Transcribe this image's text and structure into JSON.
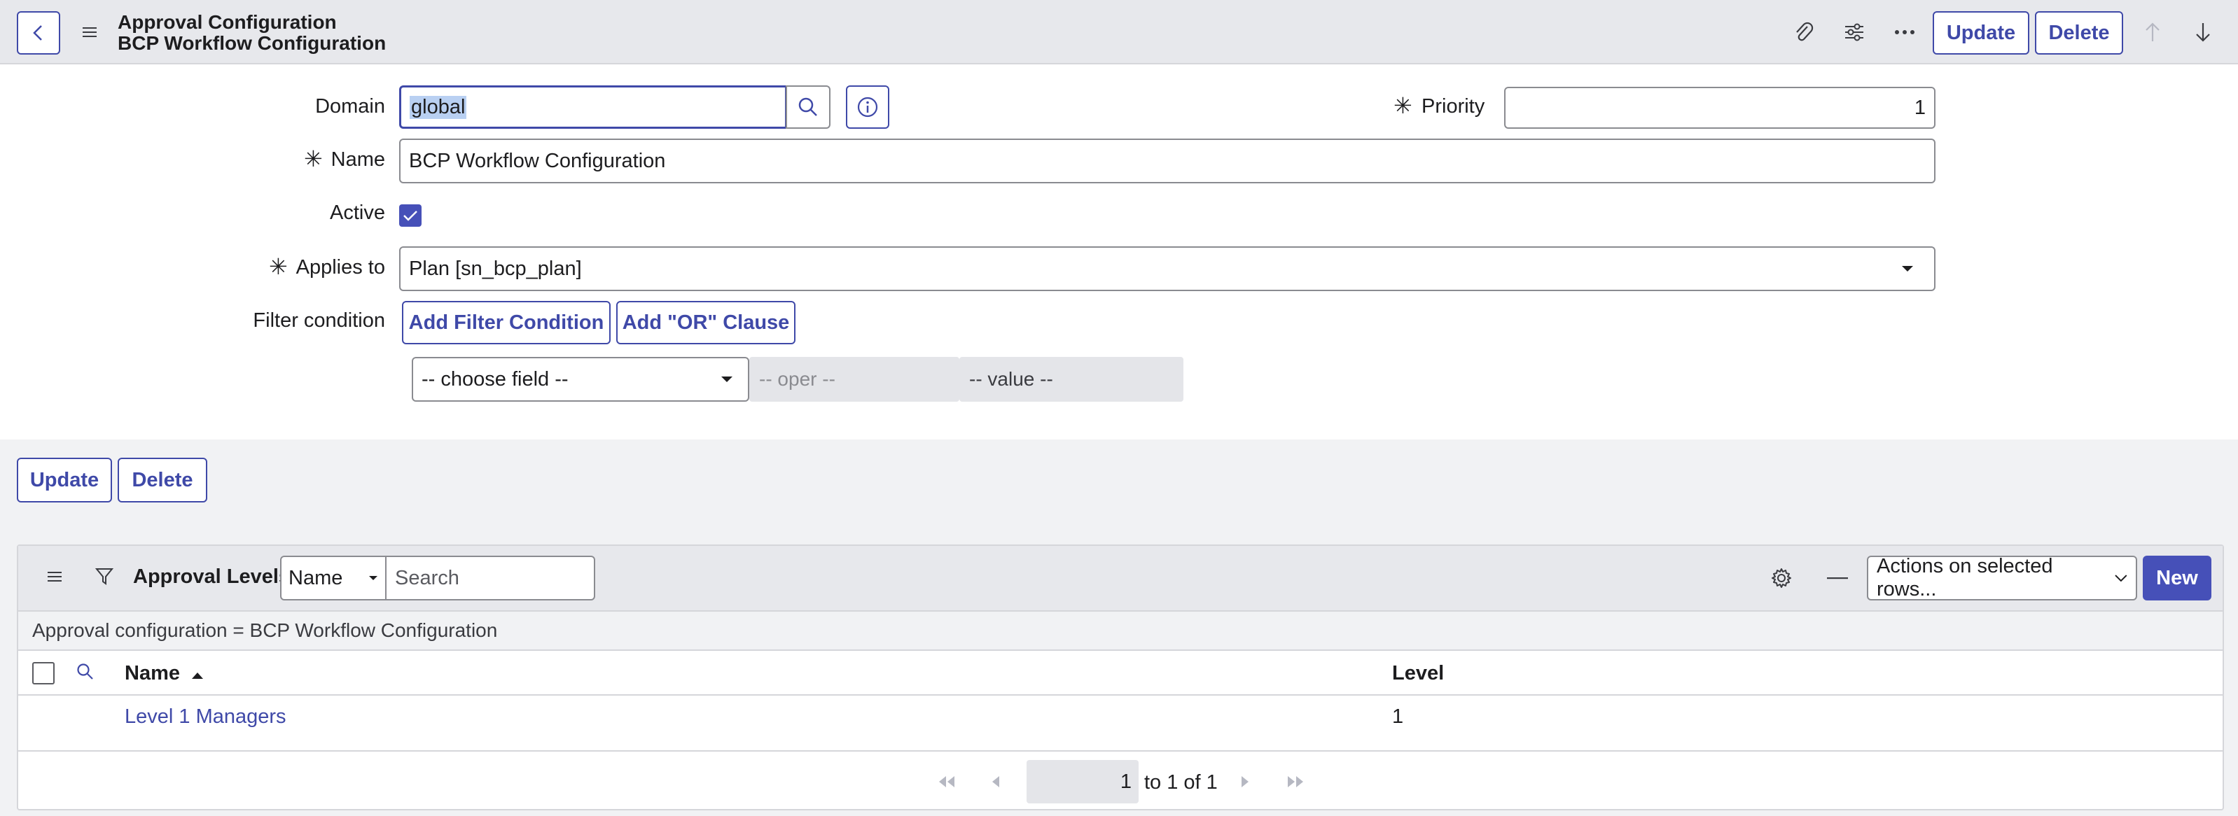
{
  "header": {
    "title": "Approval Configuration",
    "subtitle": "BCP Workflow Configuration",
    "update_label": "Update",
    "delete_label": "Delete"
  },
  "form": {
    "domain_label": "Domain",
    "domain_value": "global",
    "priority_label": "Priority",
    "priority_value": "1",
    "name_label": "Name",
    "name_value": "BCP Workflow Configuration",
    "active_label": "Active",
    "active_checked": true,
    "applies_to_label": "Applies to",
    "applies_to_value": "Plan [sn_bcp_plan]",
    "filter_label": "Filter condition",
    "add_filter_label": "Add Filter Condition",
    "add_or_label": "Add \"OR\" Clause",
    "choose_field": "-- choose field --",
    "oper": "-- oper --",
    "value": "-- value --",
    "required_mark": "✳"
  },
  "bottom_buttons": {
    "update_label": "Update",
    "delete_label": "Delete"
  },
  "related_list": {
    "title": "Approval Levels",
    "search_field": "Name",
    "search_placeholder": "Search",
    "actions_label": "Actions on selected rows...",
    "new_label": "New",
    "breadcrumb": "Approval configuration = BCP Workflow Configuration",
    "columns": [
      "Name",
      "Level"
    ],
    "rows": [
      {
        "name": "Level 1 Managers",
        "level": "1"
      }
    ],
    "pager": {
      "page": "1",
      "summary": "to 1 of 1"
    }
  },
  "colors": {
    "accent": "#3f49a8",
    "primary_button": "#4650b8"
  }
}
